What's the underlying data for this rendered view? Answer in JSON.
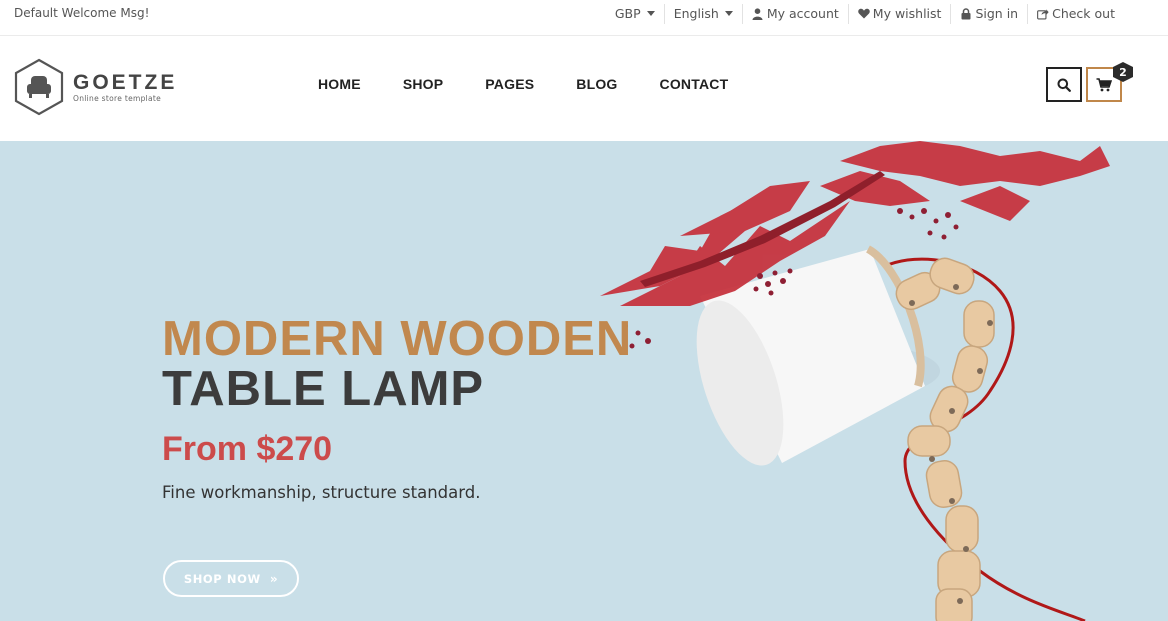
{
  "topbar": {
    "welcome": "Default Welcome Msg!",
    "currency": "GBP",
    "language": "English",
    "links": [
      {
        "label": "My account",
        "icon": "user-icon"
      },
      {
        "label": "My wishlist",
        "icon": "heart-icon"
      },
      {
        "label": "Sign in",
        "icon": "lock-icon"
      },
      {
        "label": "Check out",
        "icon": "share-icon"
      }
    ]
  },
  "brand": {
    "name": "GOETZE",
    "tagline": "Online store template"
  },
  "nav": [
    "HOME",
    "SHOP",
    "PAGES",
    "BLOG",
    "CONTACT"
  ],
  "cart": {
    "count": "2"
  },
  "hero": {
    "title_line1": "MODERN WOODEN",
    "title_line2": "TABLE LAMP",
    "price": "From $270",
    "description": "Fine workmanship, structure standard.",
    "button_label": "SHOP NOW",
    "button_icon": "double-chevron-right-icon"
  },
  "colors": {
    "accent": "#c1884e",
    "price": "#cc4b4b",
    "hero_bg": "#c9dfe8",
    "dark": "#3c3c3c"
  }
}
